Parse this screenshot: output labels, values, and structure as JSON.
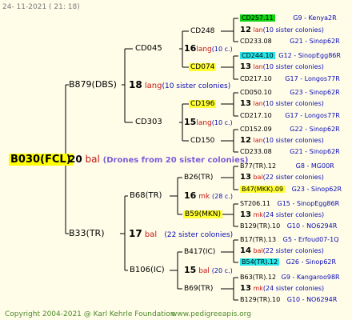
{
  "date_stamp": "24- 11-2021 ( 21: 18)",
  "footer": {
    "copyright": "Copyright 2004-2021 @ Karl Kehrle Foundation",
    "site": "www.pedigreeapis.org"
  },
  "root": {
    "label": "B030(FCL)",
    "count": "20",
    "bal": "bal",
    "drones": "(Drones from 20 sister colonies)"
  },
  "gen2": [
    {
      "label": "B879(DBS)",
      "count": "18",
      "text": "lang",
      "sisters": "(10 sister colonies)"
    },
    {
      "label": "B33(TR)",
      "count": "17",
      "text": "bal",
      "sisters": "(22 sister colonies)"
    }
  ],
  "gen3": [
    {
      "label": "CD045",
      "count": "16",
      "text": "lang",
      "sisters": "(10 c.)"
    },
    {
      "label": "CD303",
      "count": "15",
      "text": "lang",
      "sisters": "(10 c.)"
    },
    {
      "label": "B68(TR)",
      "count": "16",
      "text": "mk",
      "sisters": "(28 c.)"
    },
    {
      "label": "B106(IC)",
      "count": "15",
      "text": "bal",
      "sisters": "(20 c.)"
    }
  ],
  "gen4": [
    {
      "label": "CD248"
    },
    {
      "label": "CD074"
    },
    {
      "label": "CD196"
    },
    {
      "label": "CD150"
    },
    {
      "label": "B26(TR)"
    },
    {
      "label": "B59(MKN)"
    },
    {
      "label": "B417(IC)"
    },
    {
      "label": "B69(TR)"
    }
  ],
  "gen5": [
    {
      "label": "CD257.11",
      "info": "G9 - Kenya2R",
      "count": "12",
      "text": "lan",
      "sisters": "(10 sister colonies)",
      "sire": "CD233.08",
      "sire_info": "G21 - Sinop62R"
    },
    {
      "label": "CD244.10",
      "info": "G12 - SinopEgg86R",
      "count": "13",
      "text": "lan",
      "sisters": "(10 sister colonies)",
      "sire": "CD217.10",
      "sire_info": "G17 - Longos77R"
    },
    {
      "label": "CD050.10",
      "info": "G23 - Sinop62R",
      "count": "13",
      "text": "lan",
      "sisters": "(10 sister colonies)",
      "sire": "CD217.10",
      "sire_info": "G17 - Longos77R"
    },
    {
      "label": "CD152.09",
      "info": "G22 - Sinop62R",
      "count": "12",
      "text": "lan",
      "sisters": "(10 sister colonies)",
      "sire": "CD233.08",
      "sire_info": "G21 - Sinop62R"
    },
    {
      "label": "B77(TR).12",
      "info": "G8 - MG00R",
      "count": "13",
      "text": "bal",
      "sisters": "(22 sister colonies)",
      "sire": "B47(MKK).09",
      "sire_info": "G23 - Sinop62R"
    },
    {
      "label": "ST206.11",
      "info": "G15 - SinopEgg86R",
      "count": "13",
      "text": "mk",
      "sisters": "(24 sister colonies)",
      "sire": "B129(TR).10",
      "sire_info": "G10 - NO6294R"
    },
    {
      "label": "B17(TR).13",
      "info": "G5 - Erfoud07-1Q",
      "count": "14",
      "text": "bal",
      "sisters": "(22 sister colonies)",
      "sire": "B54(TR).12",
      "sire_info": "G26 - Sinop62R"
    },
    {
      "label": "B63(TR).12",
      "info": "G9 - Kangaroo98R",
      "count": "13",
      "text": "mk",
      "sisters": "(24 sister colonies)",
      "sire": "B129(TR).10",
      "sire_info": "G10 - NO6294R"
    }
  ]
}
